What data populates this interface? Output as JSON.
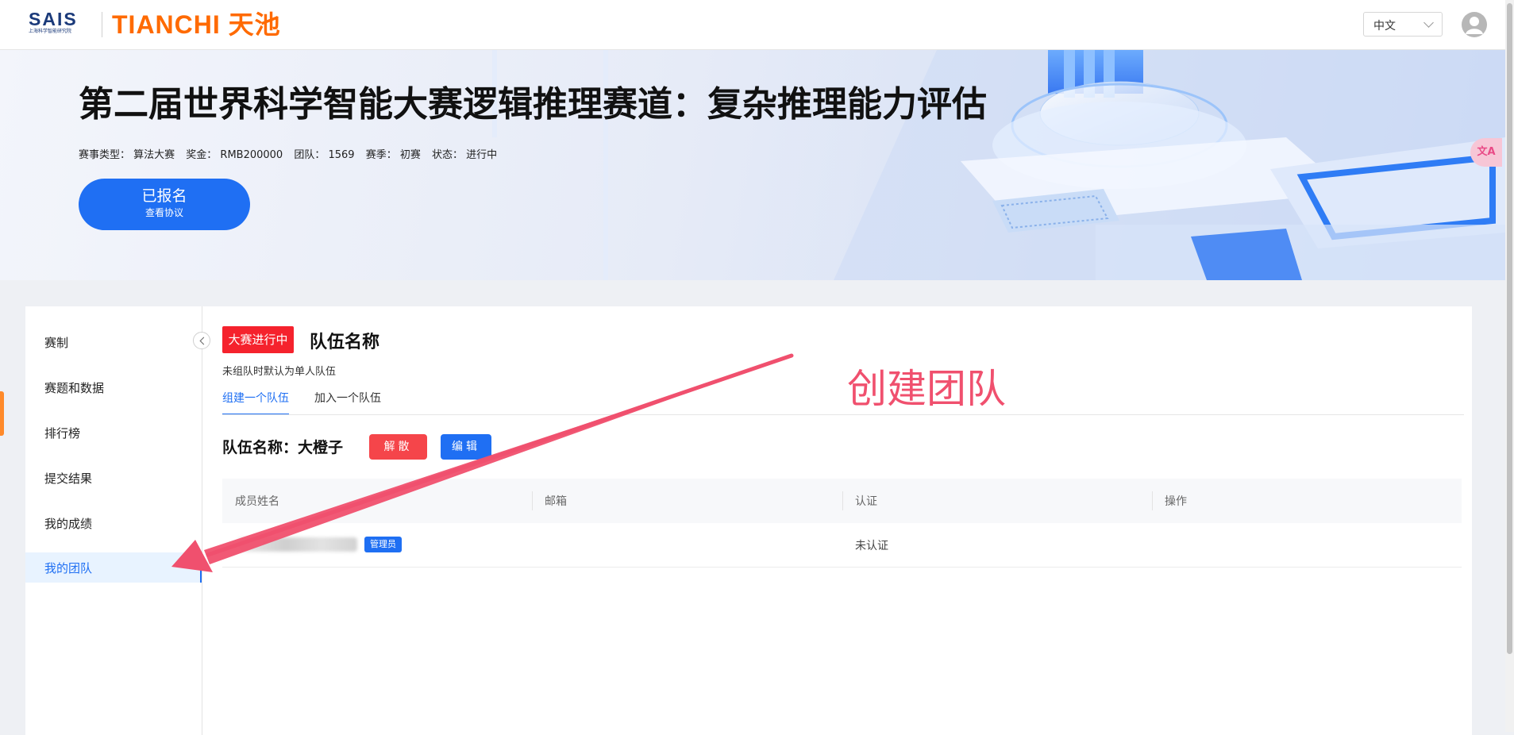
{
  "header": {
    "logo_sais": "SAIS",
    "logo_sais_sub": "上海科学智能研究院",
    "logo_tianchi": "TIANCHI 天池",
    "language": "中文"
  },
  "banner": {
    "title": "第二届世界科学智能大赛逻辑推理赛道：复杂推理能力评估",
    "meta": {
      "type": "赛事类型： 算法大赛",
      "prize": "奖金： RMB200000",
      "teams": "团队： 1569",
      "season": "赛季： 初赛",
      "status": "状态： 进行中"
    },
    "register_button": "已报名",
    "register_sub": "查看协议",
    "translate_icon_text": "文A"
  },
  "sidebar": {
    "items": [
      {
        "label": "赛制"
      },
      {
        "label": "赛题和数据"
      },
      {
        "label": "排行榜"
      },
      {
        "label": "提交结果"
      },
      {
        "label": "我的成绩"
      },
      {
        "label": "我的团队",
        "active": true
      }
    ]
  },
  "team": {
    "status_badge": "大赛进行中",
    "section_title": "队伍名称",
    "hint": "未组队时默认为单人队伍",
    "tabs": [
      "组建一个队伍",
      "加入一个队伍"
    ],
    "team_name_label": "队伍名称：大橙子",
    "dissolve_button": "解散",
    "edit_button": "编辑",
    "table": {
      "columns": [
        "成员姓名",
        "邮箱",
        "认证",
        "操作"
      ],
      "rows": [
        {
          "name_hidden": true,
          "role": "管理员",
          "email": "",
          "certification": "未认证",
          "action": ""
        }
      ]
    }
  },
  "annotation": {
    "text": "创建团队",
    "color": "#f0506e"
  },
  "colors": {
    "primary": "#1f6ff3",
    "danger": "#f5454a",
    "badge_red": "#f5222d",
    "tianchi_orange": "#ff6a00"
  }
}
